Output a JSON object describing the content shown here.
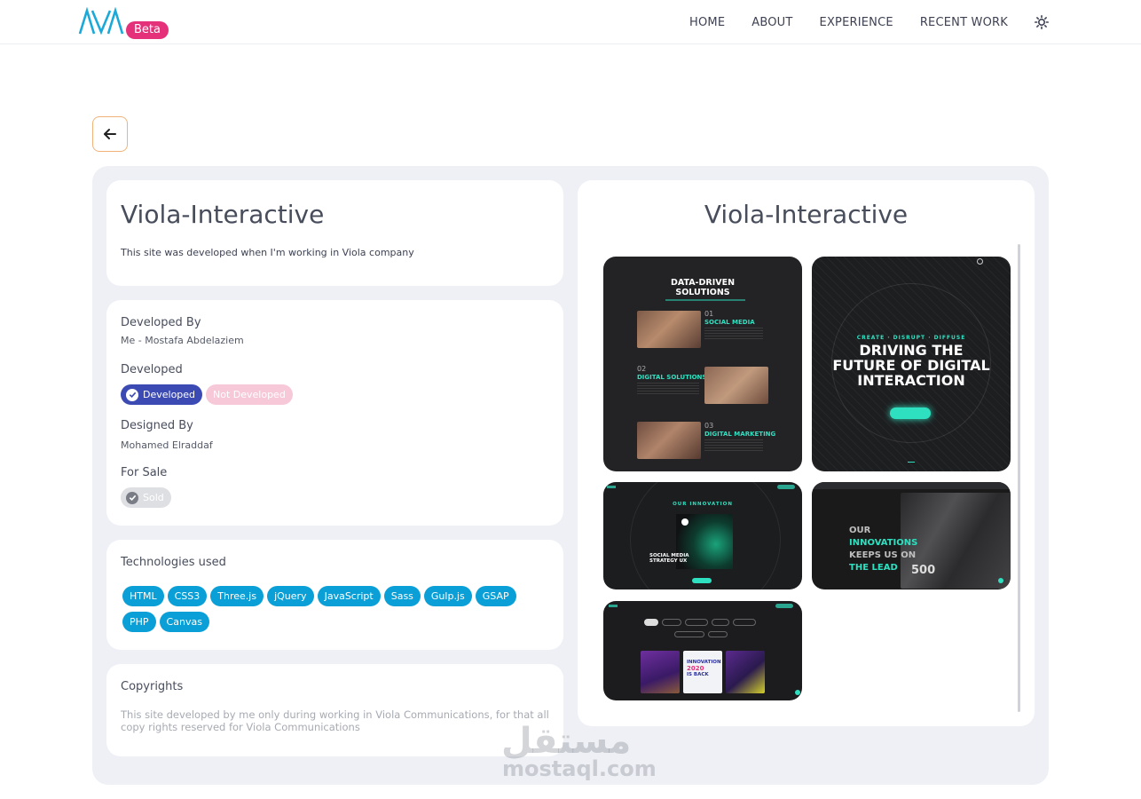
{
  "nav": {
    "logo_text": "AYA",
    "beta": "Beta",
    "links": [
      "HOME",
      "ABOUT",
      "EXPERIENCE",
      "RECENT WORK"
    ],
    "theme_icon": "sun-icon"
  },
  "back_icon": "arrow-left-icon",
  "project": {
    "title": "Viola-Interactive",
    "description": "This site was developed when I'm working in Viola company"
  },
  "info": {
    "developed_by_label": "Developed By",
    "developed_by_value": "Me - Mostafa Abdelaziem",
    "developed_label": "Developed",
    "developed_option": "Developed",
    "not_developed_option": "Not Developed",
    "designed_by_label": "Designed By",
    "designed_by_value": "Mohamed Elraddaf",
    "for_sale_label": "For Sale",
    "sold": "Sold"
  },
  "technologies": {
    "label": "Technologies used",
    "items": [
      "HTML",
      "CSS3",
      "Three.js",
      "jQuery",
      "JavaScript",
      "Sass",
      "Gulp.js",
      "GSAP",
      "PHP",
      "Canvas"
    ]
  },
  "copyrights": {
    "label": "Copyrights",
    "text": "This site developed by me only during working in Viola Communications, for that all copy rights reserved for Viola Communications"
  },
  "gallery": {
    "title": "Viola-Interactive",
    "shot1": {
      "heading_line1": "DATA-DRIVEN",
      "heading_line2": "SOLUTIONS",
      "n1": "01",
      "s1": "SOCIAL MEDIA",
      "n2": "02",
      "s2": "DIGITAL SOLUTIONS",
      "n3": "03",
      "s3": "DIGITAL MARKETING"
    },
    "shot2": {
      "tagline": "CREATE · DISRUPT · DIFFUSE",
      "line1": "DRIVING THE",
      "line2": "FUTURE OF DIGITAL",
      "line3": "INTERACTION"
    },
    "shot3": {
      "title": "OUR INNOVATION",
      "caption_line1": "SOCIAL MEDIA",
      "caption_line2": "STRATEGY UX"
    },
    "shot4": {
      "line1": "OUR",
      "line2": "INNOVATIONS",
      "line3": "KEEPS US ON",
      "line4": "THE LEAD",
      "number": "500"
    },
    "shot5": {
      "label1": "INNOVATION",
      "label2": "2020",
      "label3": "IS BACK"
    }
  },
  "watermark": {
    "arabic": "مستقل",
    "latin": "mostaql.com"
  },
  "colors": {
    "accent_blue": "#3c4bb4",
    "tech_blue": "#0a9fd6",
    "beta_pink": "#e5317a",
    "teal": "#2fe0c0"
  }
}
